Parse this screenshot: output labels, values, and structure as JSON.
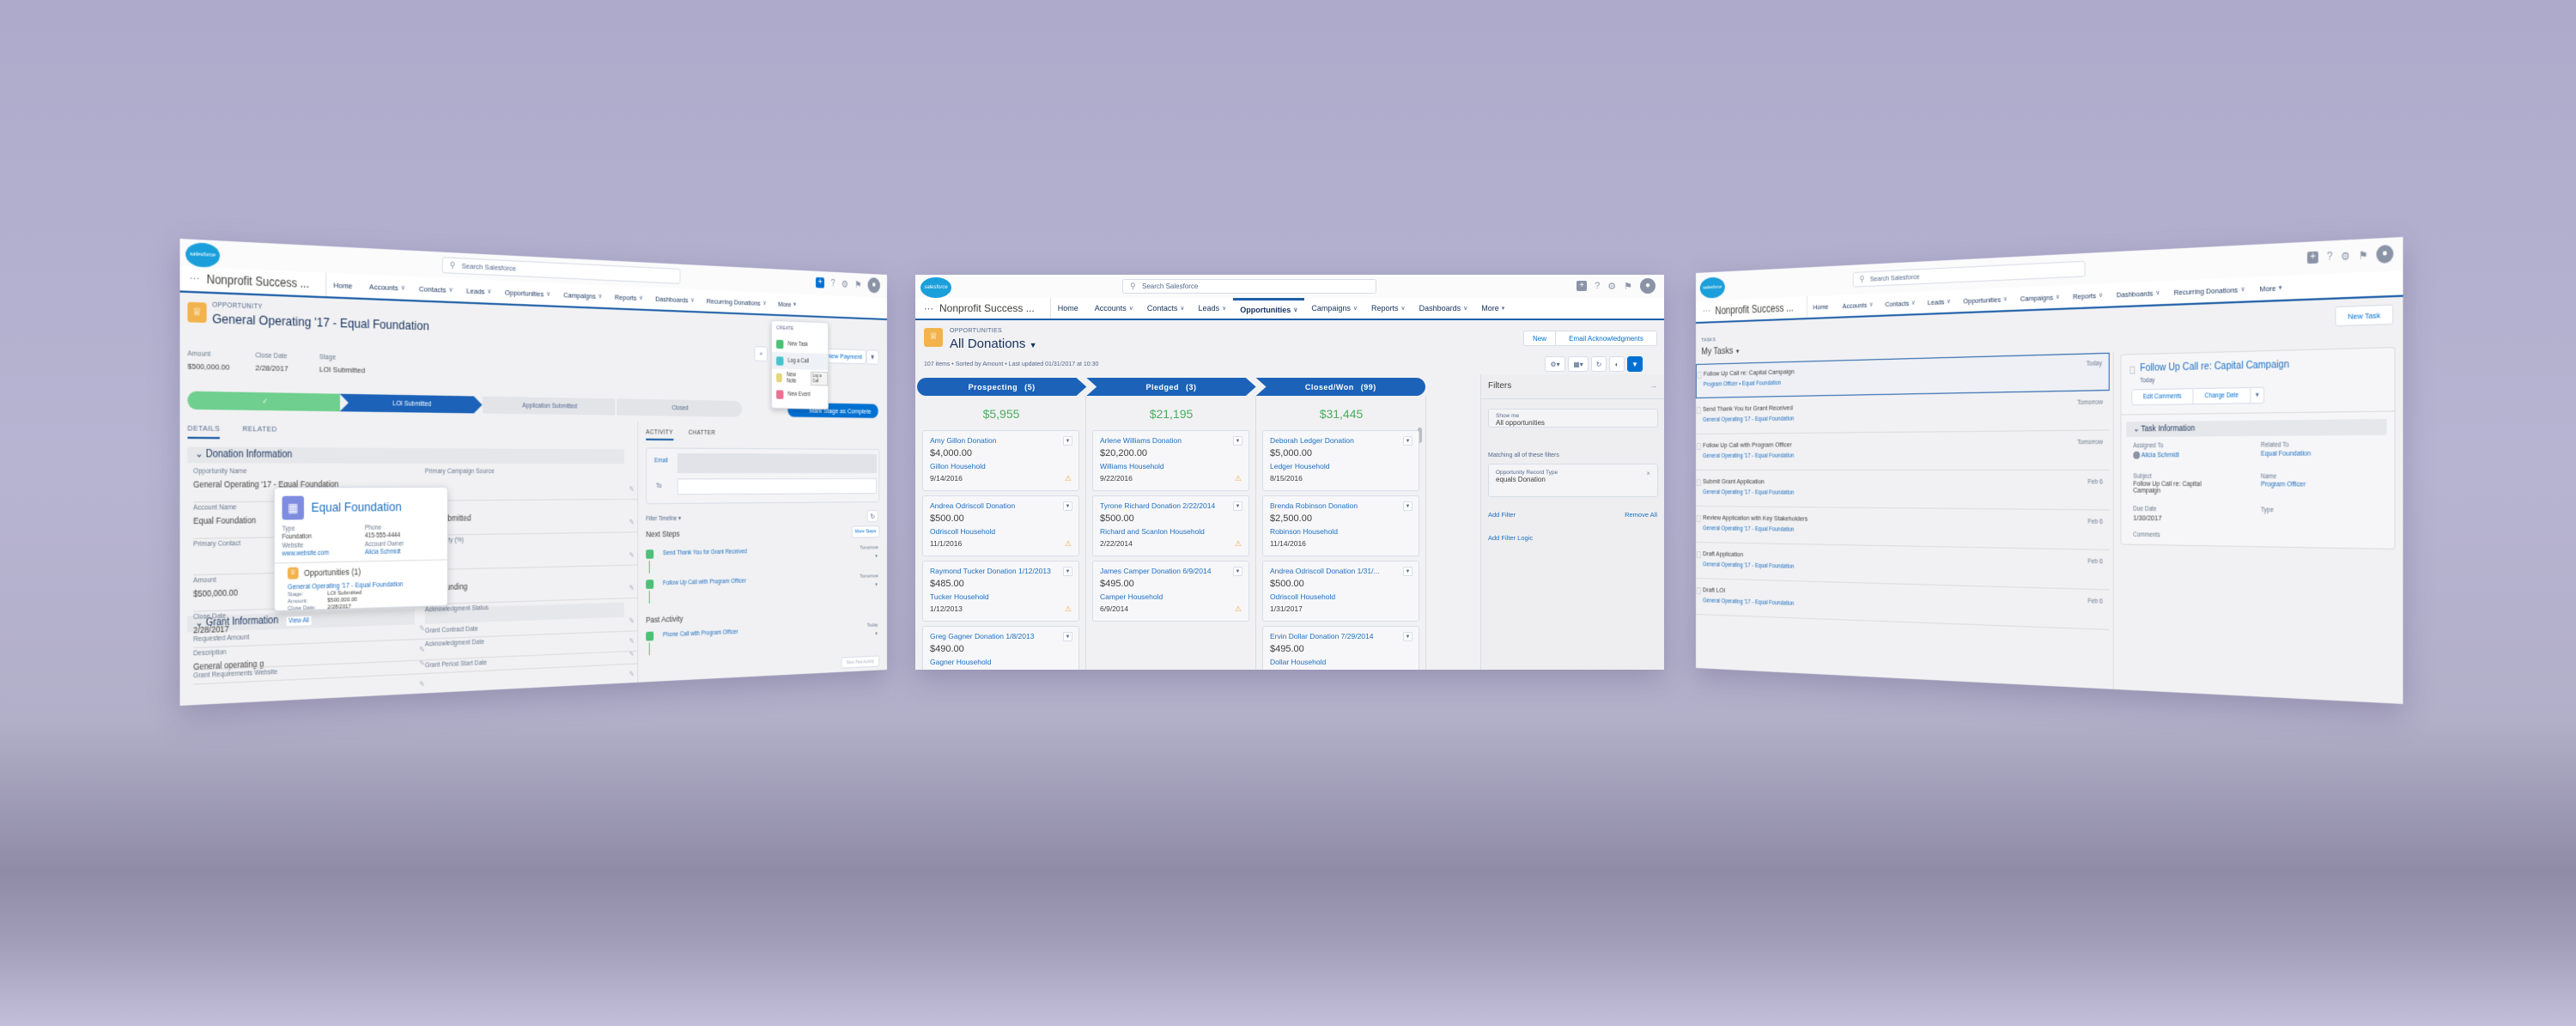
{
  "colors": {
    "brand": "#0070d2",
    "path": "#1b62b8",
    "path_done": "#6fcf8e",
    "amount": "#4bab5e",
    "link": "#1d6fc1",
    "warning": "#f2a93b",
    "background": "#b3b0cf"
  },
  "global": {
    "logo_text": "salesforce",
    "search_placeholder": "Search Salesforce",
    "app_name": "Nonprofit Success ...",
    "icons": [
      "plus-icon",
      "help-icon",
      "gear-icon",
      "bell-icon",
      "avatar-icon"
    ]
  },
  "left": {
    "nav": [
      "Home",
      "Accounts",
      "Contacts",
      "Leads",
      "Opportunities",
      "Campaigns",
      "Reports",
      "Dashboards",
      "Recurring Donations",
      "More"
    ],
    "object_label": "OPPORTUNITY",
    "title": "General Operating '17 - Equal Foundation",
    "highlights": [
      {
        "label": "Amount",
        "value": "$500,000.00"
      },
      {
        "label": "Close Date",
        "value": "2/28/2017"
      },
      {
        "label": "Stage",
        "value": "LOI Submitted"
      }
    ],
    "new_payment": "New Payment",
    "path": {
      "current": "LOI Submitted",
      "next": "Application Submitted",
      "last": "Closed",
      "mark_complete": "Mark Stage as Complete"
    },
    "tabs": [
      "DETAILS",
      "RELATED"
    ],
    "section_donation": "Donation Information",
    "section_grant": "Grant Information",
    "fields_left": [
      {
        "label": "Opportunity Name",
        "value": "General Operating '17 - Equal Foundation"
      },
      {
        "label": "Account Name",
        "value": "Equal Foundation"
      },
      {
        "label": "Primary Contact",
        "value": ""
      },
      {
        "label": "Amount",
        "value": "$500,000.00"
      },
      {
        "label": "Close Date",
        "value": "2/28/2017"
      },
      {
        "label": "Description",
        "value": "General operating g"
      }
    ],
    "fields_left_grant": [
      {
        "label": "Requested Amount",
        "value": ""
      },
      {
        "label": "Grant Requirements Website",
        "value": ""
      }
    ],
    "fields_right": [
      {
        "label": "Primary Campaign Source",
        "value": ""
      },
      {
        "label": "Stage",
        "value": "LOI Submitted"
      },
      {
        "label": "Probability (%)",
        "value": "20%"
      },
      {
        "label": "Type",
        "value": "New Funding"
      },
      {
        "label": "Acknowledgment Status",
        "value": ""
      },
      {
        "label": "Acknowledgment Date",
        "value": ""
      }
    ],
    "fields_right_grant": [
      {
        "label": "Grant Contract Date",
        "value": ""
      },
      {
        "label": "Grant Period Start Date",
        "value": ""
      }
    ],
    "create_menu": {
      "header": "CREATE",
      "items": [
        "New Task",
        "Log a Call",
        "New Note",
        "New Event"
      ],
      "tooltip": "Log a Call"
    },
    "hover_card": {
      "name": "Equal Foundation",
      "type_label": "Type",
      "type": "Foundation",
      "phone_label": "Phone",
      "phone": "415-555-4444",
      "website_label": "Website",
      "website": "www.website.com",
      "owner_label": "Account Owner",
      "owner": "Alicia Schmidt",
      "opps_title": "Opportunities (1)",
      "opp_name": "General Operating '17 - Equal Foundation",
      "stage_label": "Stage:",
      "stage": "LOI Submitted",
      "amount_label": "Amount:",
      "amount": "$500,000.00",
      "close_label": "Close Date:",
      "close": "2/28/2017",
      "view_all": "View All"
    },
    "activity": {
      "tabs": [
        "ACTIVITY",
        "CHATTER"
      ],
      "email_label": "Email",
      "to_label": "To",
      "filter": "Filter Timeline",
      "next_steps": "Next Steps",
      "more_steps": "More Steps",
      "next_items": [
        {
          "title": "Send Thank You for Grant Received",
          "when": "Tomorrow"
        },
        {
          "title": "Follow Up Call with Program Officer",
          "when": "Tomorrow"
        }
      ],
      "past_activity": "Past Activity",
      "past_items": [
        {
          "title": "Phone Call with Program Officer",
          "when": "Today"
        }
      ],
      "more_past": "More Past Activity"
    }
  },
  "center": {
    "nav": [
      "Home",
      "Accounts",
      "Contacts",
      "Leads",
      "Opportunities",
      "Campaigns",
      "Reports",
      "Dashboards",
      "More"
    ],
    "active_nav": "Opportunities",
    "object_label": "OPPORTUNITIES",
    "list_name": "All Donations",
    "summary": "107 items • Sorted by Amount • Last updated 01/31/2017 at 10:30",
    "buttons": [
      "New",
      "Email Acknowledgments"
    ],
    "toolbar_icons": [
      "gear-icon",
      "columns-icon",
      "refresh-icon",
      "chart-icon",
      "filter-icon"
    ],
    "columns": [
      {
        "name": "Prospecting",
        "count": "(5)",
        "total": "$5,955",
        "cards": [
          {
            "name": "Amy Gillon Donation",
            "amount": "$4,000.00",
            "account": "Gillon Household",
            "date": "9/14/2016",
            "warning": true
          },
          {
            "name": "Andrea Odriscoll Donation",
            "amount": "$500.00",
            "account": "Odriscoll Household",
            "date": "11/1/2016",
            "warning": true
          },
          {
            "name": "Raymond Tucker Donation 1/12/2013",
            "amount": "$485.00",
            "account": "Tucker Household",
            "date": "1/12/2013",
            "warning": true
          },
          {
            "name": "Greg Gagner Donation 1/8/2013",
            "amount": "$490.00",
            "account": "Gagner Household",
            "date": "",
            "warning": false
          }
        ]
      },
      {
        "name": "Pledged",
        "count": "(3)",
        "total": "$21,195",
        "cards": [
          {
            "name": "Arlene Williams Donation",
            "amount": "$20,200.00",
            "account": "Williams Household",
            "date": "9/22/2016",
            "warning": true
          },
          {
            "name": "Tyrone Richard Donation 2/22/2014",
            "amount": "$500.00",
            "account": "Richard and Scanlon Household",
            "date": "2/22/2014",
            "warning": true
          },
          {
            "name": "James Camper Donation 6/9/2014",
            "amount": "$495.00",
            "account": "Camper Household",
            "date": "6/9/2014",
            "warning": true
          }
        ]
      },
      {
        "name": "Closed/Won",
        "count": "(99)",
        "total": "$31,445",
        "cards": [
          {
            "name": "Deborah Ledger Donation",
            "amount": "$5,000.00",
            "account": "Ledger Household",
            "date": "8/15/2016",
            "warning": false
          },
          {
            "name": "Brenda Robinson Donation",
            "amount": "$2,500.00",
            "account": "Robinson Household",
            "date": "11/14/2016",
            "warning": false
          },
          {
            "name": "Andrea Odriscoll Donation 1/31/...",
            "amount": "$500.00",
            "account": "Odriscoll Household",
            "date": "1/31/2017",
            "warning": false
          },
          {
            "name": "Ervin Dollar Donation 7/29/2014",
            "amount": "$495.00",
            "account": "Dollar Household",
            "date": "",
            "warning": false
          }
        ]
      }
    ],
    "filters": {
      "title": "Filters",
      "show_me_label": "Show me",
      "show_me_value": "All opportunities",
      "matching": "Matching all of these filters",
      "filter_field": "Opportunity Record Type",
      "filter_value": "equals  Donation",
      "add_filter": "Add Filter",
      "remove_all": "Remove All",
      "add_logic": "Add Filter Logic"
    }
  },
  "right": {
    "nav": [
      "Home",
      "Accounts",
      "Contacts",
      "Leads",
      "Opportunities",
      "Campaigns",
      "Reports",
      "Dashboards",
      "Recurring Donations",
      "More"
    ],
    "object_label": "TASKS",
    "list_name": "My Tasks",
    "new_task": "New Task",
    "tasks": [
      {
        "title": "Follow Up Call re: Capital Campaign",
        "sub": "Program Officer • Equal Foundation",
        "when": "Today",
        "selected": true
      },
      {
        "title": "Send Thank You for Grant Received",
        "sub": "General Operating '17 - Equal Foundation",
        "when": "Tomorrow"
      },
      {
        "title": "Follow Up Call with Program Officer",
        "sub": "General Operating '17 - Equal Foundation",
        "when": "Tomorrow"
      },
      {
        "title": "Submit Grant Application",
        "sub": "General Operating '17 - Equal Foundation",
        "when": "Feb 6"
      },
      {
        "title": "Review Application with Key Stakeholders",
        "sub": "General Operating '17 - Equal Foundation",
        "when": "Feb 6"
      },
      {
        "title": "Draft Application",
        "sub": "General Operating '17 - Equal Foundation",
        "when": "Feb 6"
      },
      {
        "title": "Draft LOI",
        "sub": "General Operating '17 - Equal Foundation",
        "when": "Feb 6"
      }
    ],
    "detail": {
      "title": "Follow Up Call re: Capital Campaign",
      "when": "Today",
      "edit_comments": "Edit Comments",
      "change_date": "Change Date",
      "section": "Task Information",
      "assigned_label": "Assigned To",
      "assigned": "Alicia Schmidt",
      "related_label": "Related To",
      "related": "Equal Foundation",
      "subject_label": "Subject",
      "subject": "Follow Up Call re: Capital Campaign",
      "name_label": "Name",
      "name": "Program Officer",
      "due_label": "Due Date",
      "due": "1/30/2017",
      "type_label": "Type",
      "type": "",
      "comments_label": "Comments"
    }
  }
}
